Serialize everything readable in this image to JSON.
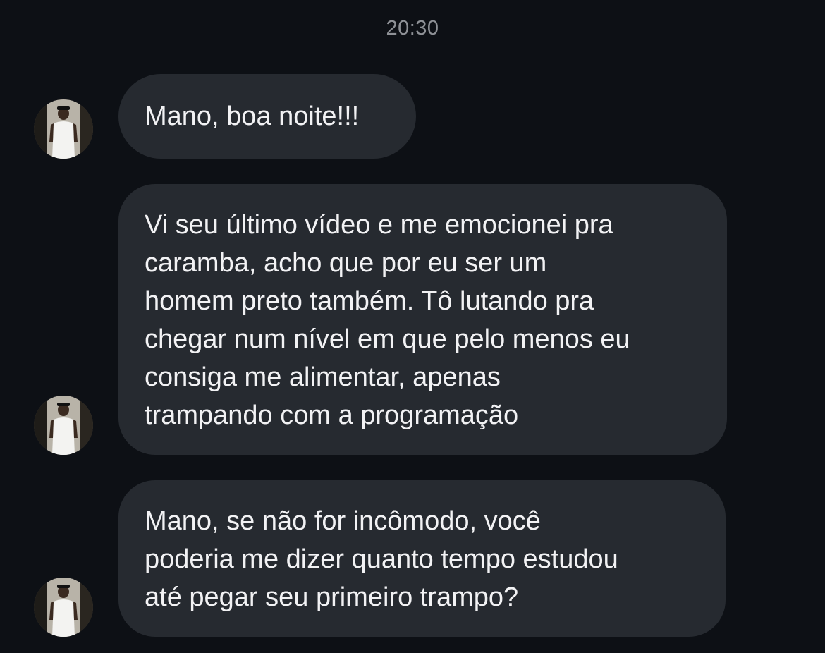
{
  "conversation": {
    "timestamp": "20:30",
    "messages": [
      {
        "text": "Mano, boa noite!!!",
        "avatar_icon": "user-avatar-icon"
      },
      {
        "text": "Vi seu último vídeo e me emocionei pra\ncaramba, acho que por eu ser um\nhomem preto também. Tô lutando pra\nchegar num nível em que pelo menos eu\nconsiga me alimentar, apenas\ntrampando com a programação",
        "avatar_icon": "user-avatar-icon"
      },
      {
        "text": "Mano, se não for incômodo, você\npoderia me dizer quanto tempo estudou\naté pegar seu primeiro trampo?",
        "avatar_icon": "user-avatar-icon"
      }
    ]
  },
  "colors": {
    "background": "#0d1015",
    "bubble": "#262a30",
    "text": "#f2f2f4",
    "timestamp": "#8e9196"
  }
}
